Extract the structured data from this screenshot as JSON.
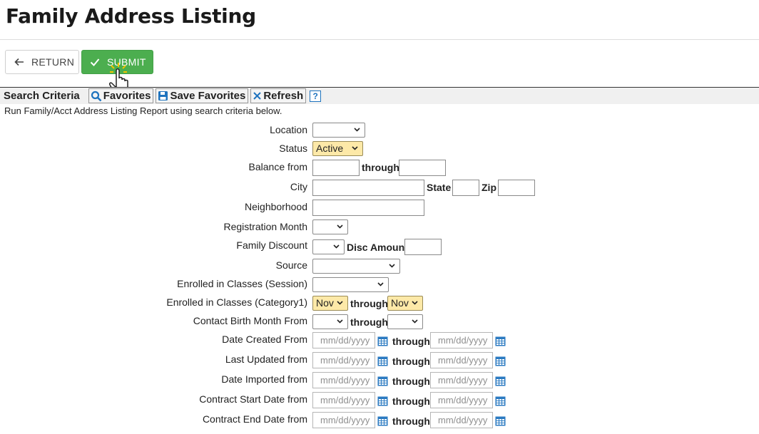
{
  "page": {
    "title": "Family Address Listing"
  },
  "actions": {
    "return_label": "RETURN",
    "submit_label": "SUBMIT"
  },
  "toolbar": {
    "criteria_label": "Search Criteria",
    "favorites_label": "Favorites",
    "save_favorites_label": "Save Favorites",
    "refresh_label": "Refresh",
    "help_label": "?"
  },
  "instructions": "Run Family/Acct Address Listing Report using search criteria below.",
  "form": {
    "location": {
      "label": "Location",
      "value": ""
    },
    "status": {
      "label": "Status",
      "value": "Active"
    },
    "balance": {
      "label": "Balance from",
      "through": "through"
    },
    "city": {
      "label": "City",
      "state": "State",
      "zip": "Zip"
    },
    "neighborhood": {
      "label": "Neighborhood"
    },
    "registration_month": {
      "label": "Registration Month",
      "value": ""
    },
    "family_discount": {
      "label": "Family Discount",
      "value": "",
      "disc_amount": "Disc Amount"
    },
    "source": {
      "label": "Source",
      "value": ""
    },
    "enrolled_session": {
      "label": "Enrolled in Classes (Session)",
      "value": ""
    },
    "enrolled_category": {
      "label": "Enrolled in Classes (Category1)",
      "from": "Nov",
      "through": "through",
      "to": "Nov"
    },
    "birth_month": {
      "label": "Contact Birth Month From",
      "from": "",
      "through": "through",
      "to": ""
    },
    "date_rows": [
      {
        "label": "Date Created From",
        "through": "through",
        "placeholder": "mm/dd/yyyy"
      },
      {
        "label": "Last Updated from",
        "through": "through",
        "placeholder": "mm/dd/yyyy"
      },
      {
        "label": "Date Imported from",
        "through": "through",
        "placeholder": "mm/dd/yyyy"
      },
      {
        "label": "Contract Start Date from",
        "through": "through",
        "placeholder": "mm/dd/yyyy"
      },
      {
        "label": "Contract End Date from",
        "through": "through",
        "placeholder": "mm/dd/yyyy"
      }
    ]
  },
  "colors": {
    "submit_green": "#4cae4f",
    "highlight_select": "#fde9a8",
    "calendar_blue": "#2b7ac1"
  }
}
